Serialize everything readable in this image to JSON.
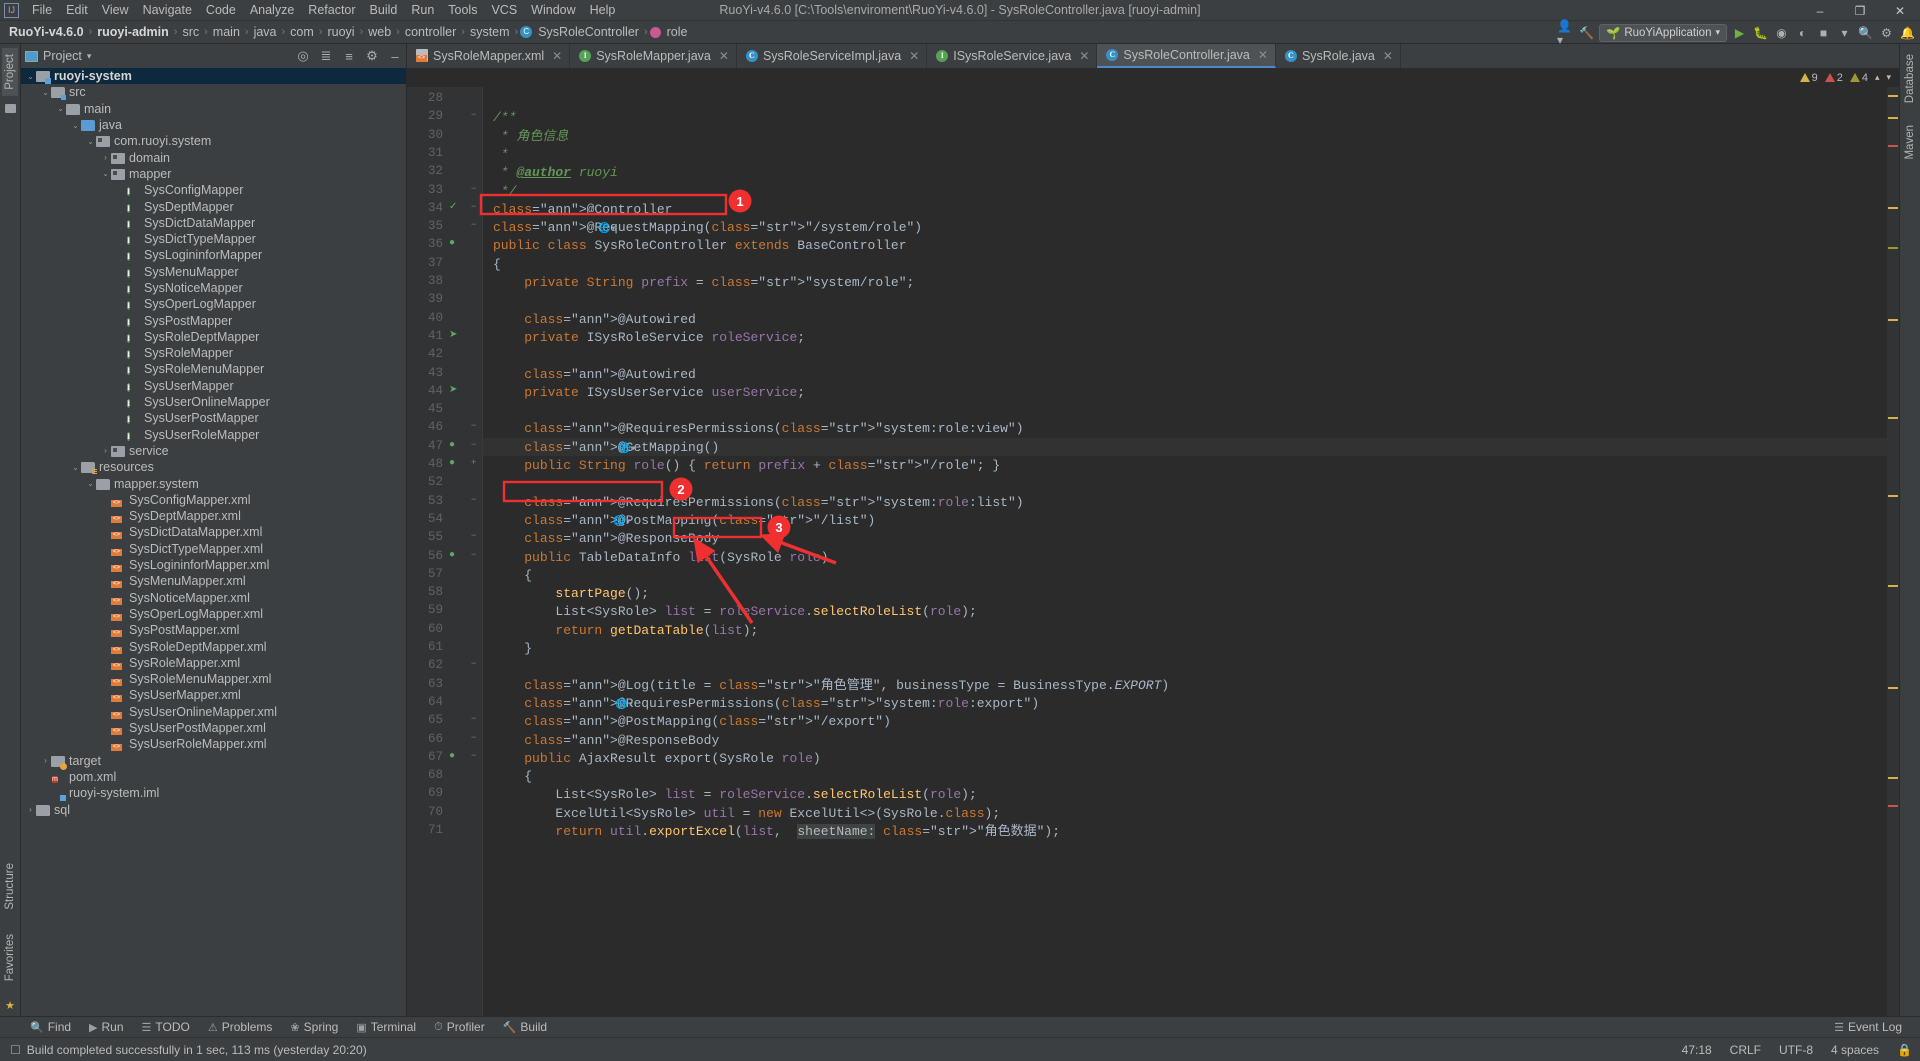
{
  "window": {
    "title": "RuoYi-v4.6.0 [C:\\Tools\\enviroment\\RuoYi-v4.6.0] - SysRoleController.java [ruoyi-admin]",
    "minimize": "–",
    "maximize": "❐",
    "close": "✕"
  },
  "menu": [
    "File",
    "Edit",
    "View",
    "Navigate",
    "Code",
    "Analyze",
    "Refactor",
    "Build",
    "Run",
    "Tools",
    "VCS",
    "Window",
    "Help"
  ],
  "breadcrumb": {
    "items": [
      "RuoYi-v4.6.0",
      "ruoyi-admin",
      "src",
      "main",
      "java",
      "com",
      "ruoyi",
      "web",
      "controller",
      "system",
      "SysRoleController",
      "role"
    ],
    "separator": "›",
    "run_config": "RuoYiApplication"
  },
  "project_panel": {
    "title": "Project",
    "vertical_tabs_left": [
      "Project",
      "Structure",
      "Favorites"
    ],
    "vertical_tabs_right": [
      "Database",
      "Maven"
    ],
    "tree": [
      {
        "depth": 1,
        "label": "ruoyi-system",
        "arrow": "⌄",
        "icon": "module-icon",
        "bold": true,
        "selected": true
      },
      {
        "depth": 2,
        "label": "src",
        "arrow": "⌄",
        "icon": "folder-src-icon"
      },
      {
        "depth": 3,
        "label": "main",
        "arrow": "⌄",
        "icon": "folder-icon"
      },
      {
        "depth": 4,
        "label": "java",
        "arrow": "⌄",
        "icon": "folder-sources-icon"
      },
      {
        "depth": 5,
        "label": "com.ruoyi.system",
        "arrow": "⌄",
        "icon": "package-icon"
      },
      {
        "depth": 6,
        "label": "domain",
        "arrow": "›",
        "icon": "package-icon"
      },
      {
        "depth": 6,
        "label": "mapper",
        "arrow": "⌄",
        "icon": "package-icon"
      },
      {
        "depth": 7,
        "label": "SysConfigMapper",
        "arrow": "",
        "icon": "interface-icon"
      },
      {
        "depth": 7,
        "label": "SysDeptMapper",
        "arrow": "",
        "icon": "interface-icon"
      },
      {
        "depth": 7,
        "label": "SysDictDataMapper",
        "arrow": "",
        "icon": "interface-icon"
      },
      {
        "depth": 7,
        "label": "SysDictTypeMapper",
        "arrow": "",
        "icon": "interface-icon"
      },
      {
        "depth": 7,
        "label": "SysLogininforMapper",
        "arrow": "",
        "icon": "interface-icon"
      },
      {
        "depth": 7,
        "label": "SysMenuMapper",
        "arrow": "",
        "icon": "interface-icon"
      },
      {
        "depth": 7,
        "label": "SysNoticeMapper",
        "arrow": "",
        "icon": "interface-icon"
      },
      {
        "depth": 7,
        "label": "SysOperLogMapper",
        "arrow": "",
        "icon": "interface-icon"
      },
      {
        "depth": 7,
        "label": "SysPostMapper",
        "arrow": "",
        "icon": "interface-icon"
      },
      {
        "depth": 7,
        "label": "SysRoleDeptMapper",
        "arrow": "",
        "icon": "interface-icon"
      },
      {
        "depth": 7,
        "label": "SysRoleMapper",
        "arrow": "",
        "icon": "interface-icon"
      },
      {
        "depth": 7,
        "label": "SysRoleMenuMapper",
        "arrow": "",
        "icon": "interface-icon"
      },
      {
        "depth": 7,
        "label": "SysUserMapper",
        "arrow": "",
        "icon": "interface-icon"
      },
      {
        "depth": 7,
        "label": "SysUserOnlineMapper",
        "arrow": "",
        "icon": "interface-icon"
      },
      {
        "depth": 7,
        "label": "SysUserPostMapper",
        "arrow": "",
        "icon": "interface-icon"
      },
      {
        "depth": 7,
        "label": "SysUserRoleMapper",
        "arrow": "",
        "icon": "interface-icon"
      },
      {
        "depth": 6,
        "label": "service",
        "arrow": "›",
        "icon": "package-icon"
      },
      {
        "depth": 4,
        "label": "resources",
        "arrow": "⌄",
        "icon": "folder-resources-icon"
      },
      {
        "depth": 5,
        "label": "mapper.system",
        "arrow": "⌄",
        "icon": "folder-icon"
      },
      {
        "depth": 6,
        "label": "SysConfigMapper.xml",
        "arrow": "",
        "icon": "xml-icon"
      },
      {
        "depth": 6,
        "label": "SysDeptMapper.xml",
        "arrow": "",
        "icon": "xml-icon"
      },
      {
        "depth": 6,
        "label": "SysDictDataMapper.xml",
        "arrow": "",
        "icon": "xml-icon"
      },
      {
        "depth": 6,
        "label": "SysDictTypeMapper.xml",
        "arrow": "",
        "icon": "xml-icon"
      },
      {
        "depth": 6,
        "label": "SysLogininforMapper.xml",
        "arrow": "",
        "icon": "xml-icon"
      },
      {
        "depth": 6,
        "label": "SysMenuMapper.xml",
        "arrow": "",
        "icon": "xml-icon"
      },
      {
        "depth": 6,
        "label": "SysNoticeMapper.xml",
        "arrow": "",
        "icon": "xml-icon"
      },
      {
        "depth": 6,
        "label": "SysOperLogMapper.xml",
        "arrow": "",
        "icon": "xml-icon"
      },
      {
        "depth": 6,
        "label": "SysPostMapper.xml",
        "arrow": "",
        "icon": "xml-icon"
      },
      {
        "depth": 6,
        "label": "SysRoleDeptMapper.xml",
        "arrow": "",
        "icon": "xml-icon"
      },
      {
        "depth": 6,
        "label": "SysRoleMapper.xml",
        "arrow": "",
        "icon": "xml-icon"
      },
      {
        "depth": 6,
        "label": "SysRoleMenuMapper.xml",
        "arrow": "",
        "icon": "xml-icon"
      },
      {
        "depth": 6,
        "label": "SysUserMapper.xml",
        "arrow": "",
        "icon": "xml-icon"
      },
      {
        "depth": 6,
        "label": "SysUserOnlineMapper.xml",
        "arrow": "",
        "icon": "xml-icon"
      },
      {
        "depth": 6,
        "label": "SysUserPostMapper.xml",
        "arrow": "",
        "icon": "xml-icon"
      },
      {
        "depth": 6,
        "label": "SysUserRoleMapper.xml",
        "arrow": "",
        "icon": "xml-icon"
      },
      {
        "depth": 2,
        "label": "target",
        "arrow": "›",
        "icon": "folder-target-icon"
      },
      {
        "depth": 2,
        "label": "pom.xml",
        "arrow": "",
        "icon": "maven-icon"
      },
      {
        "depth": 2,
        "label": "ruoyi-system.iml",
        "arrow": "",
        "icon": "iml-icon"
      },
      {
        "depth": 1,
        "label": "sql",
        "arrow": "›",
        "icon": "folder-icon"
      }
    ]
  },
  "editor": {
    "tabs": [
      {
        "label": "SysRoleMapper.xml",
        "icon": "xml-icon",
        "active": false
      },
      {
        "label": "SysRoleMapper.java",
        "icon": "interface-icon",
        "active": false
      },
      {
        "label": "SysRoleServiceImpl.java",
        "icon": "class-icon",
        "active": false
      },
      {
        "label": "ISysRoleService.java",
        "icon": "interface-icon",
        "active": false
      },
      {
        "label": "SysRoleController.java",
        "icon": "class-icon",
        "active": true
      },
      {
        "label": "SysRole.java",
        "icon": "class-icon",
        "active": false
      }
    ],
    "inspections": {
      "warnings": "9",
      "errors": "2",
      "weak_warnings": "4"
    },
    "line_numbers": [
      "28",
      "29",
      "30",
      "31",
      "32",
      "33",
      "34",
      "35",
      "36",
      "37",
      "38",
      "39",
      "40",
      "41",
      "42",
      "43",
      "44",
      "45",
      "46",
      "47",
      "48",
      "52",
      "53",
      "54",
      "55",
      "56",
      "57",
      "58",
      "59",
      "60",
      "61",
      "62",
      "63",
      "64",
      "65",
      "66",
      "67",
      "68",
      "69",
      "70",
      "71"
    ],
    "code_lines": [
      "",
      "/**",
      " * 角色信息",
      " * ",
      " * @author ruoyi",
      " */",
      "@Controller",
      "@RequestMapping(\"/system/role\")",
      "public class SysRoleController extends BaseController",
      "{",
      "    private String prefix = \"system/role\";",
      "",
      "    @Autowired",
      "    private ISysRoleService roleService;",
      "",
      "    @Autowired",
      "    private ISysUserService userService;",
      "",
      "    @RequiresPermissions(\"system:role:view\")",
      "    @GetMapping()",
      "    public String role() { return prefix + \"/role\"; }",
      "",
      "    @RequiresPermissions(\"system:role:list\")",
      "    @PostMapping(\"/list\")",
      "    @ResponseBody",
      "    public TableDataInfo list(SysRole role)",
      "    {",
      "        startPage();",
      "        List<SysRole> list = roleService.selectRoleList(role);",
      "        return getDataTable(list);",
      "    }",
      "",
      "    @Log(title = \"角色管理\", businessType = BusinessType.EXPORT)",
      "    @RequiresPermissions(\"system:role:export\")",
      "    @PostMapping(\"/export\")",
      "    @ResponseBody",
      "    public AjaxResult export(SysRole role)",
      "    {",
      "        List<SysRole> list = roleService.selectRoleList(role);",
      "        ExcelUtil<SysRole> util = new ExcelUtil<>(SysRole.class);",
      "        return util.exportExcel(list,  sheetName: \"角色数据\");"
    ]
  },
  "annotations": [
    {
      "number": "1",
      "target": "@RequestMapping(\"/system/role\")"
    },
    {
      "number": "2",
      "target": "@PostMapping(\"/list\")"
    },
    {
      "number": "3",
      "target": "SysRole role"
    }
  ],
  "bottom_tools": [
    {
      "label": "Find",
      "icon": "search-icon"
    },
    {
      "label": "Run",
      "icon": "play-icon"
    },
    {
      "label": "TODO",
      "icon": "todo-icon"
    },
    {
      "label": "Problems",
      "icon": "problems-icon"
    },
    {
      "label": "Spring",
      "icon": "spring-icon"
    },
    {
      "label": "Terminal",
      "icon": "terminal-icon"
    },
    {
      "label": "Profiler",
      "icon": "profiler-icon"
    },
    {
      "label": "Build",
      "icon": "build-icon"
    }
  ],
  "event_log": "Event Log",
  "status": {
    "message": "Build completed successfully in 1 sec, 113 ms (yesterday 20:20)",
    "caret": "47:18",
    "line_sep": "CRLF",
    "encoding": "UTF-8",
    "indent": "4 spaces",
    "lock_icon": "lock-icon"
  },
  "colors": {
    "accent": "#4a88c7",
    "annotation_red": "#f03030",
    "keyword": "#cc7832",
    "string": "#6a8759",
    "annotation_yellow": "#bbb529",
    "comment": "#629755",
    "method": "#ffc66d",
    "field": "#9876aa"
  }
}
